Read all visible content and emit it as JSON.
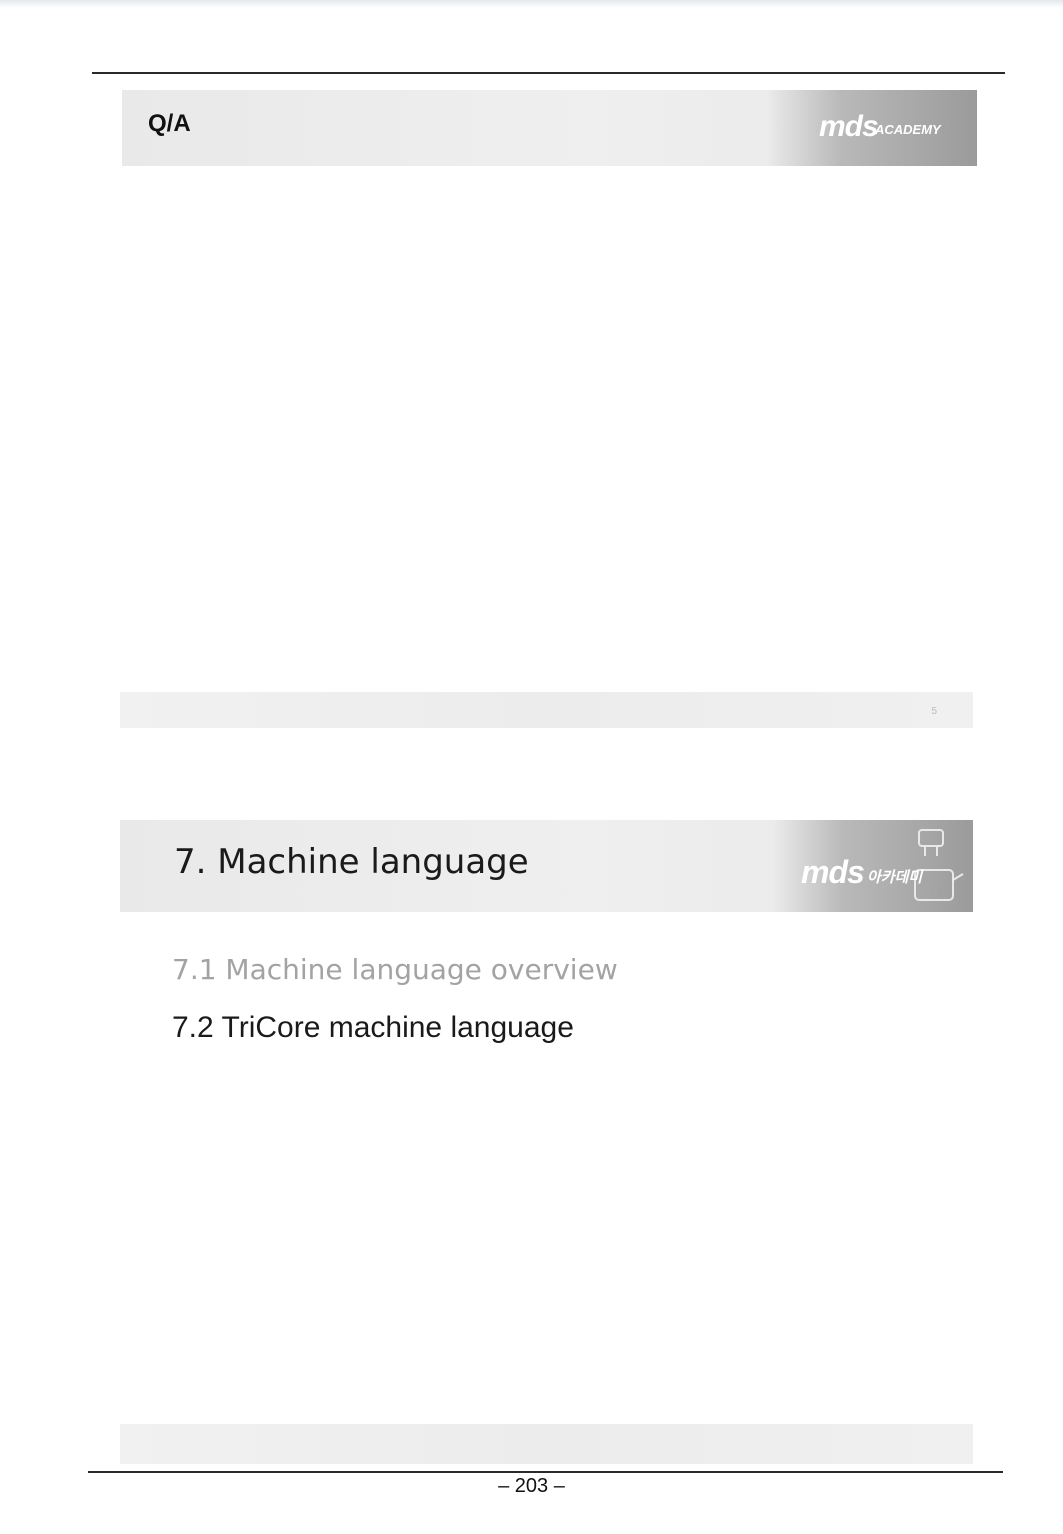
{
  "slide1": {
    "title": "Q/A",
    "logo": {
      "brand": "mds",
      "sub": "ACADEMY"
    },
    "slide_number": "5"
  },
  "slide2": {
    "title": "7. Machine language",
    "logo": {
      "brand": "mds",
      "sub": "아카데미"
    },
    "toc": [
      {
        "label": "7.1 Machine language overview"
      },
      {
        "label": "7.2 TriCore machine language"
      }
    ]
  },
  "page_number": "– 203 –",
  "colors": {
    "header_bg": "#ececec",
    "logo_bg": "#9b9b9b",
    "toc_inactive": "#a3a3a3",
    "toc_active": "#1a1a1a"
  }
}
